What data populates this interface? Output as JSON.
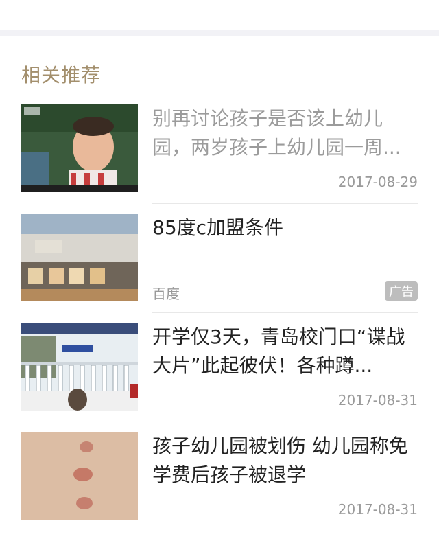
{
  "section": {
    "title": "相关推荐"
  },
  "items": [
    {
      "title": "别再讨论孩子是否该上幼儿园，两岁孩子上幼儿园一周...",
      "date": "2017-08-29",
      "title_color": "gray",
      "image": "crying-child-photo"
    },
    {
      "title": "85度c加盟条件",
      "source": "百度",
      "badge": "广告",
      "title_color": "dark",
      "image": "storefront-photo"
    },
    {
      "title": "开学仅3天，青岛校门口“谍战大片”此起彼伏！各种蹲...",
      "date": "2017-08-31",
      "title_color": "dark",
      "image": "school-gate-photo"
    },
    {
      "title": "孩子幼儿园被划伤 幼儿园称免学费后孩子被退学",
      "date": "2017-08-31",
      "title_color": "dark",
      "image": "scratched-skin-photo"
    }
  ],
  "colors": {
    "section_title": "#a38f6d",
    "title_gray": "#9b9b9b",
    "title_dark": "#222222",
    "meta": "#9a9a9a",
    "badge_bg": "#bdbdbd"
  }
}
